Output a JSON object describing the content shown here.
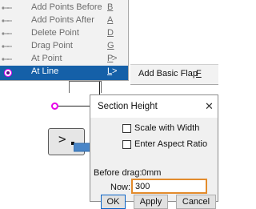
{
  "menu": {
    "items": [
      {
        "label": "Add Points Before",
        "key": "B",
        "icon": "point-tool-icon"
      },
      {
        "label": "Add Points After",
        "key": "A",
        "icon": "point-tool-icon"
      },
      {
        "label": "Delete Point",
        "key": "D",
        "icon": "point-tool-icon"
      },
      {
        "label": "Drag Point",
        "key": "G",
        "icon": "point-tool-icon"
      },
      {
        "label": "At Point",
        "key": "P",
        "arrow": ">",
        "icon": "point-tool-icon"
      },
      {
        "label": "At Line",
        "key": "L",
        "arrow": ">",
        "icon": "radio-selected-icon"
      }
    ]
  },
  "submenu": {
    "label": "Add Basic Flap",
    "key": "F"
  },
  "dialog": {
    "title": "Section Height",
    "close_glyph": "✕",
    "scale_with_width": {
      "label": "Scale with Width",
      "checked": false
    },
    "enter_aspect_ratio": {
      "label": "Enter Aspect Ratio",
      "checked": false
    },
    "before_drag_label": "Before drag:",
    "before_drag_value": "0mm",
    "now_label": "Now:",
    "now_value": "300",
    "buttons": {
      "ok": "OK",
      "apply": "Apply",
      "cancel": "Cancel"
    }
  },
  "speech_icon_glyph": ">",
  "colors": {
    "menu_highlight": "#1560a8",
    "focus_border": "#e38b2c",
    "arrow": "#4a86c8",
    "marker": "#e800e8"
  }
}
